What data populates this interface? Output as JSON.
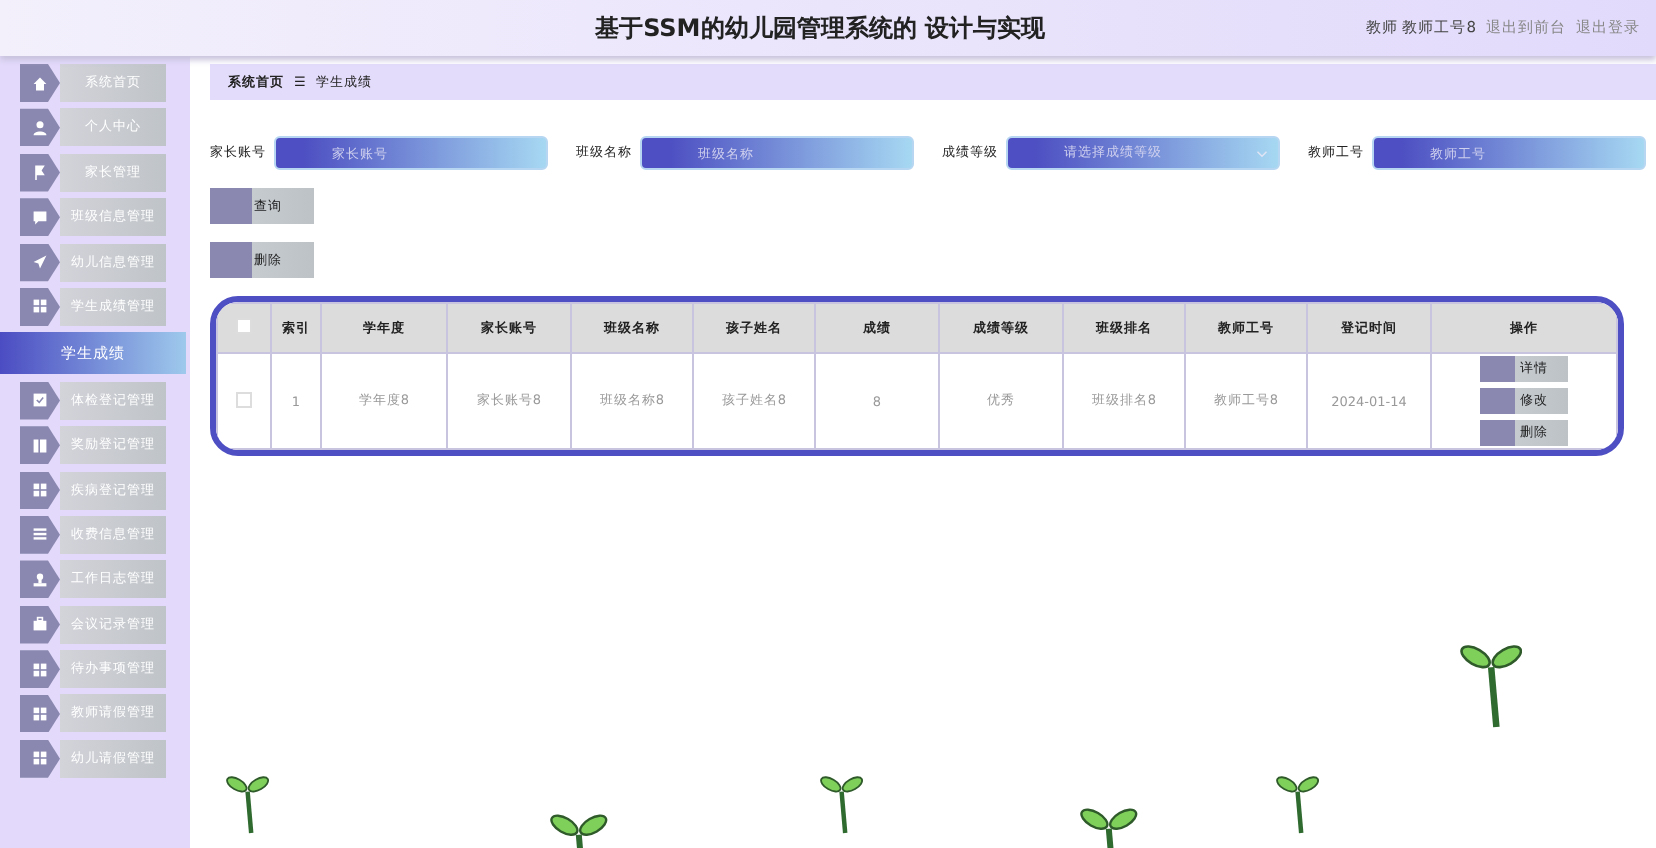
{
  "header": {
    "title": "基于SSM的幼儿园管理系统的 设计与实现",
    "user": "教师 教师工号8",
    "links": [
      "退出到前台",
      "退出登录"
    ]
  },
  "sidebar": {
    "items": [
      {
        "label": "系统首页",
        "selected": false
      },
      {
        "label": "个人中心",
        "selected": false
      },
      {
        "label": "家长管理",
        "selected": false
      },
      {
        "label": "班级信息管理",
        "selected": false
      },
      {
        "label": "幼儿信息管理",
        "selected": false
      },
      {
        "label": "学生成绩管理",
        "selected": false
      },
      {
        "label": "学生成绩",
        "selected": true
      },
      {
        "label": "体检登记管理",
        "selected": false
      },
      {
        "label": "奖励登记管理",
        "selected": false
      },
      {
        "label": "疾病登记管理",
        "selected": false
      },
      {
        "label": "收费信息管理",
        "selected": false
      },
      {
        "label": "工作日志管理",
        "selected": false
      },
      {
        "label": "会议记录管理",
        "selected": false
      },
      {
        "label": "待办事项管理",
        "selected": false
      },
      {
        "label": "教师请假管理",
        "selected": false
      },
      {
        "label": "幼儿请假管理",
        "selected": false
      }
    ]
  },
  "breadcrumb": {
    "home": "系统首页",
    "separator": "☰",
    "current": "学生成绩"
  },
  "search": {
    "fields": [
      {
        "label": "家长账号",
        "placeholder": "家长账号",
        "kind": "input"
      },
      {
        "label": "班级名称",
        "placeholder": "班级名称",
        "kind": "input"
      },
      {
        "label": "成绩等级",
        "placeholder": "请选择成绩等级",
        "kind": "select"
      },
      {
        "label": "教师工号",
        "placeholder": "教师工号",
        "kind": "input"
      }
    ],
    "buttons": [
      "查询",
      "删除"
    ]
  },
  "table": {
    "all_checked": false,
    "columns": [
      "索引",
      "学年度",
      "家长账号",
      "班级名称",
      "孩子姓名",
      "成绩",
      "成绩等级",
      "班级排名",
      "教师工号",
      "登记时间",
      "操作"
    ],
    "rows": [
      {
        "checked": false,
        "cells": [
          "1",
          "学年度8",
          "家长账号8",
          "班级名称8",
          "孩子姓名8",
          "8",
          "优秀",
          "班级排名8",
          "教师工号8",
          "2024-01-14"
        ],
        "actions": [
          "详情",
          "修改",
          "删除"
        ]
      }
    ]
  }
}
